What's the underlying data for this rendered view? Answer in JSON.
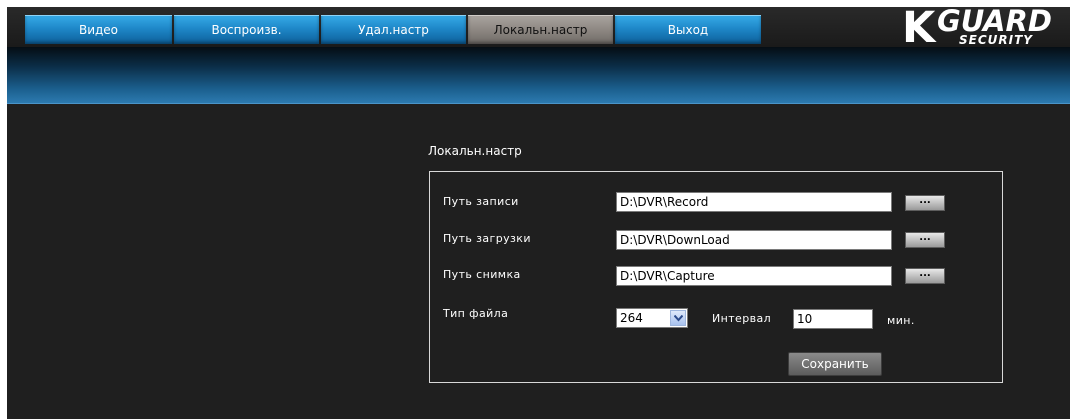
{
  "nav": {
    "tabs": [
      {
        "label": "Видео",
        "active": false
      },
      {
        "label": "Воспроизв.",
        "active": false
      },
      {
        "label": "Удал.настр",
        "active": false
      },
      {
        "label": "Локальн.настр",
        "active": true
      },
      {
        "label": "Выход",
        "active": false
      }
    ]
  },
  "logo": {
    "k": "K",
    "guard": "GUARD",
    "security": "SECURITY"
  },
  "section": {
    "title": "Локальн.настр"
  },
  "form": {
    "record_path_label": "Путь записи",
    "record_path_value": "D:\\DVR\\Record",
    "download_path_label": "Путь загрузки",
    "download_path_value": "D:\\DVR\\DownLoad",
    "capture_path_label": "Путь снимка",
    "capture_path_value": "D:\\DVR\\Capture",
    "browse_label": "...",
    "file_type_label": "Тип файла",
    "file_type_value": "264",
    "interval_label": "Интервал",
    "interval_value": "10",
    "interval_unit": "мин.",
    "save_label": "Сохранить"
  },
  "colors": {
    "tab_blue": "#1e87c8",
    "tab_active": "#8d8782",
    "background": "#1f1f1f",
    "banner_blue": "#2c7ab0"
  }
}
